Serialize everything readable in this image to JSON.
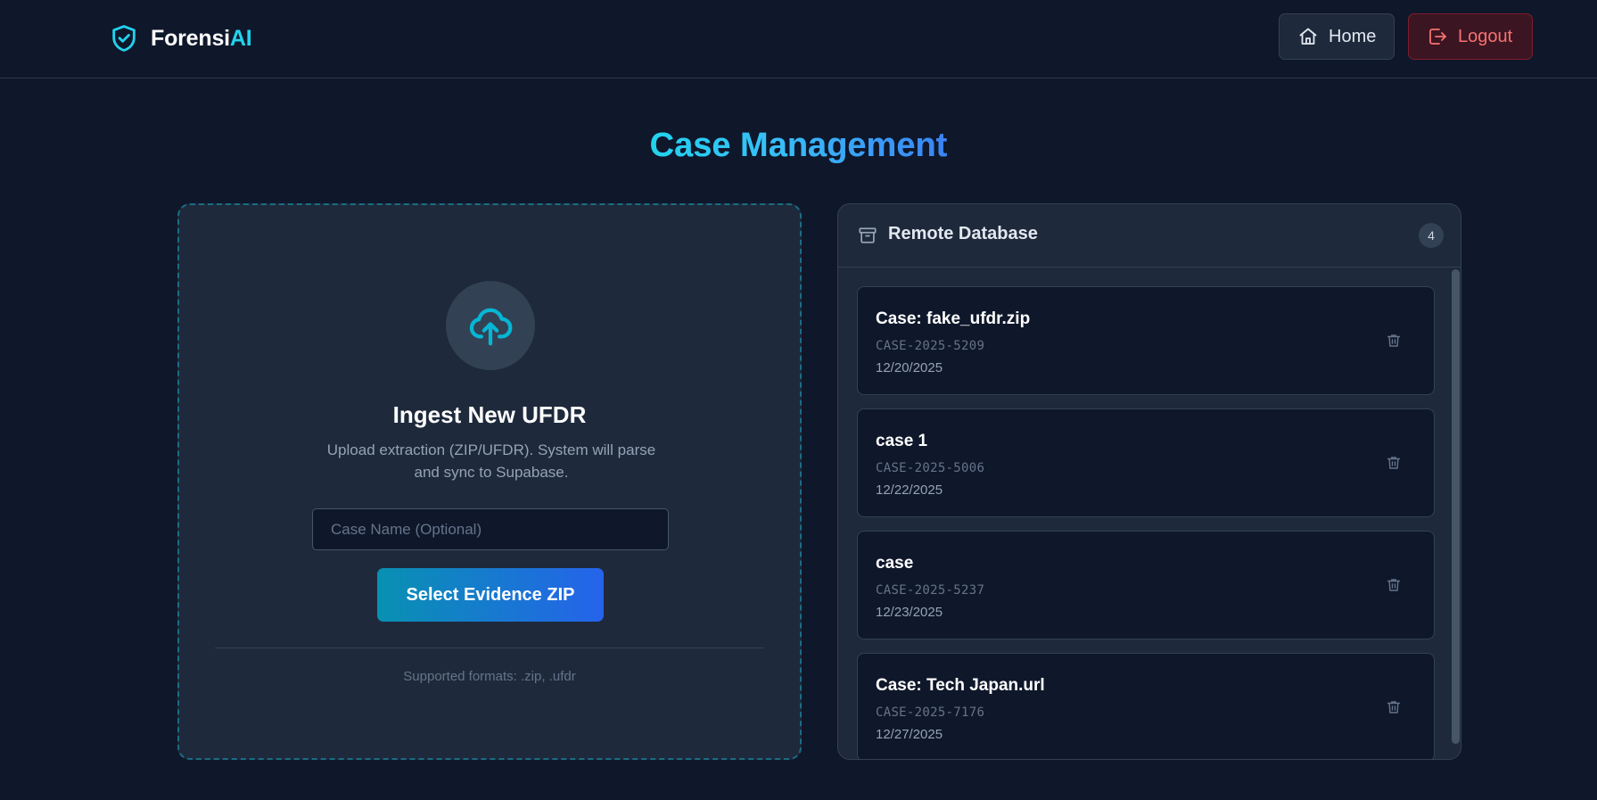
{
  "header": {
    "brand_prefix": "Forensi",
    "brand_accent": "AI",
    "home_label": "Home",
    "logout_label": "Logout"
  },
  "page": {
    "title": "Case Management"
  },
  "upload": {
    "title": "Ingest New UFDR",
    "description": "Upload extraction (ZIP/UFDR). System will parse and sync to Supabase.",
    "case_name_placeholder": "Case Name (Optional)",
    "case_name_value": "",
    "select_button_label": "Select Evidence ZIP",
    "formats_text": "Supported formats: .zip, .ufdr"
  },
  "database": {
    "title": "Remote Database",
    "count": "4",
    "cases": [
      {
        "name": "Case: fake_ufdr.zip",
        "id": "CASE-2025-5209",
        "date": "12/20/2025"
      },
      {
        "name": "case 1",
        "id": "CASE-2025-5006",
        "date": "12/22/2025"
      },
      {
        "name": "case",
        "id": "CASE-2025-5237",
        "date": "12/23/2025"
      },
      {
        "name": "Case: Tech Japan.url",
        "id": "CASE-2025-7176",
        "date": "12/27/2025"
      }
    ]
  },
  "icons": {
    "brand": "shield-check-icon",
    "home": "home-icon",
    "logout": "logout-icon",
    "upload": "cloud-upload-icon",
    "database": "archive-icon",
    "delete": "trash-icon"
  },
  "colors": {
    "background": "#0f172a",
    "panel": "#1e293b",
    "accent_cyan": "#22d3ee",
    "accent_blue": "#3b82f6",
    "danger": "#f87171"
  }
}
